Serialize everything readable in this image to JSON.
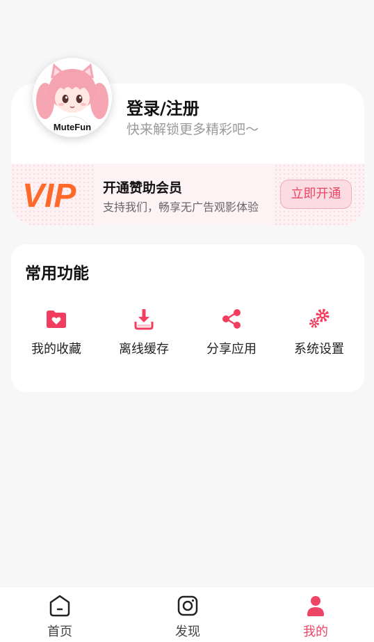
{
  "profile": {
    "name": "登录/注册",
    "subtitle": "快来解锁更多精彩吧～",
    "avatar_text": "MuteFun"
  },
  "vip": {
    "logo_text": "VIP",
    "title": "开通赞助会员",
    "subtitle": "支持我们，畅享无广告观影体验",
    "button_label": "立即开通",
    "accent_color": "#ee4566",
    "logo_color": "#ff6a2b"
  },
  "functions": {
    "title": "常用功能",
    "items": [
      {
        "label": "我的收藏",
        "icon": "favorites-folder-icon"
      },
      {
        "label": "离线缓存",
        "icon": "download-icon"
      },
      {
        "label": "分享应用",
        "icon": "share-icon"
      },
      {
        "label": "系统设置",
        "icon": "gears-icon"
      }
    ]
  },
  "nav": {
    "items": [
      {
        "label": "首页",
        "icon": "home-icon",
        "active": false
      },
      {
        "label": "发现",
        "icon": "discover-icon",
        "active": false
      },
      {
        "label": "我的",
        "icon": "user-icon",
        "active": true
      }
    ],
    "active_color": "#ee4566"
  }
}
